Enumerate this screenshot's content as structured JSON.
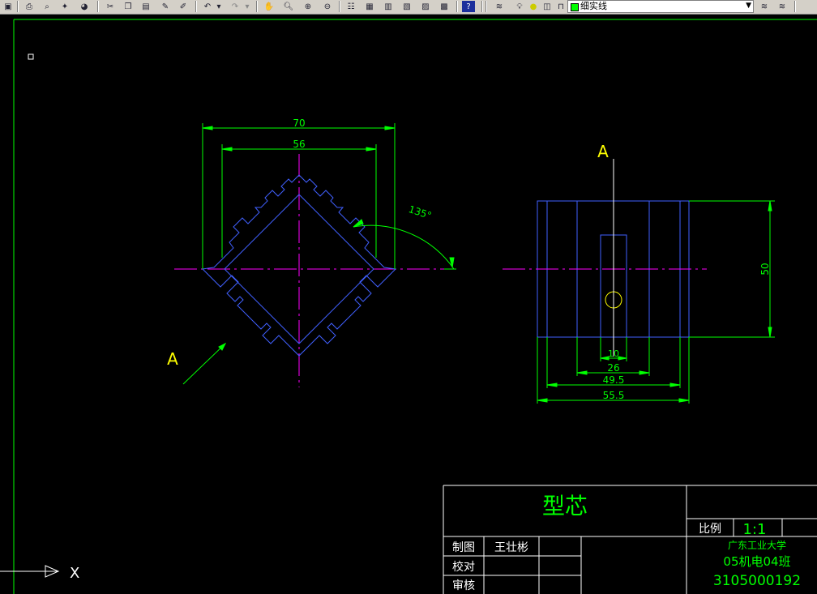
{
  "toolbar": {
    "layer_name": "细实线"
  },
  "drawing": {
    "front_view": {
      "dim_outer": "70",
      "dim_inner": "56",
      "dim_angle": "135°"
    },
    "side_view": {
      "dim_height": "50",
      "dim_10": "10",
      "dim_26": "26",
      "dim_49_5": "49.5",
      "dim_55_5": "55.5"
    },
    "view_marker_left": "A",
    "view_marker_right": "A",
    "ucs_x_label": "X"
  },
  "title_block": {
    "part_name": "型芯",
    "scale_label": "比例",
    "scale_value": "1:1",
    "drawn_label": "制图",
    "drawn_by": "王壮彬",
    "check_label": "校对",
    "review_label": "审核",
    "school": "广东工业大学",
    "class_name": "05机电04班",
    "student_id": "3105000192"
  },
  "colors": {
    "background": "#000000",
    "green": "#00ff00",
    "blue": "#4060ff",
    "magenta": "#ff00ff",
    "yellow": "#ffff00",
    "white": "#ffffff"
  }
}
